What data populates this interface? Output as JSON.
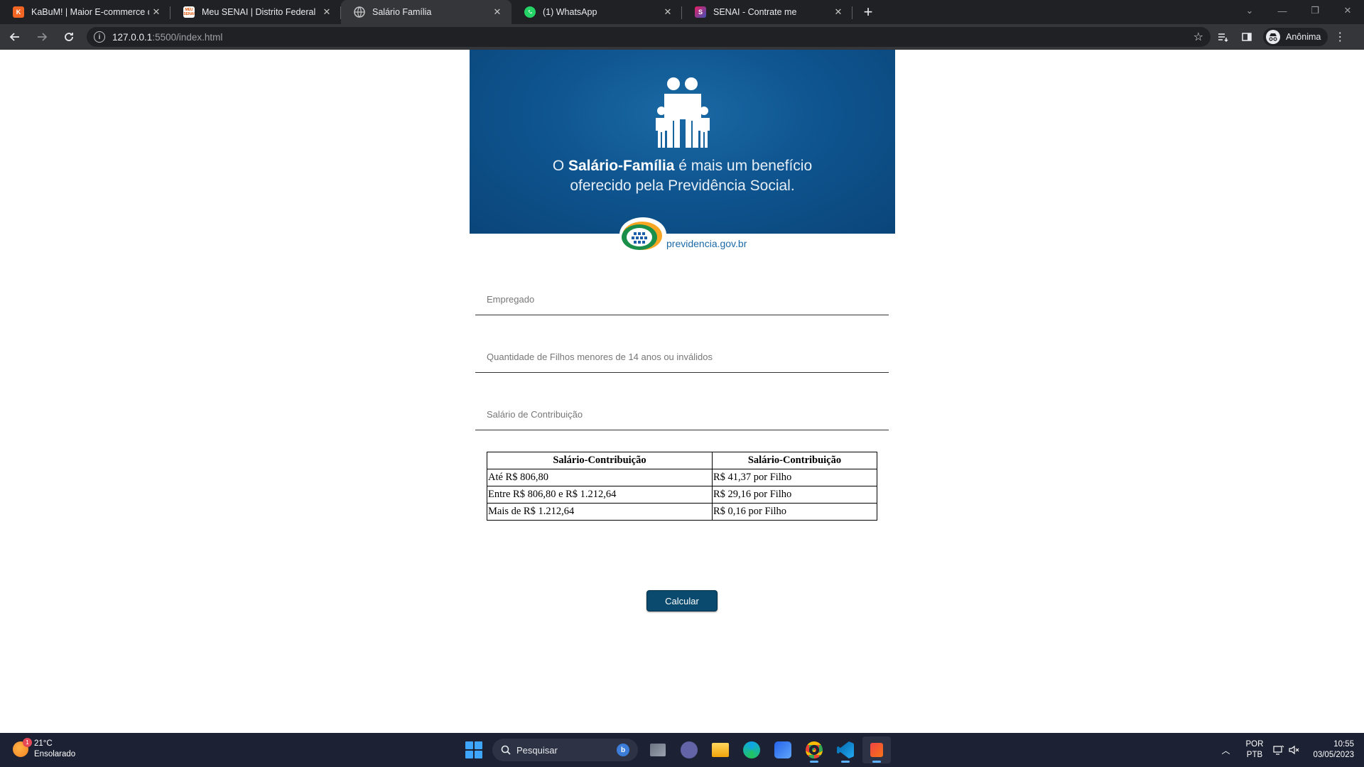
{
  "browser": {
    "tabs": [
      {
        "title": "KaBuM! | Maior E-commerce de Tecnologia",
        "favicon_color": "#f26522",
        "favicon_text": "K",
        "active": false
      },
      {
        "title": "Meu SENAI | Distrito Federal",
        "favicon_color": "#e35205",
        "favicon_text": "MEU SENAI",
        "active": false
      },
      {
        "title": "Salário Família",
        "favicon_color": "#9aa0a6",
        "favicon_text": "",
        "active": true
      },
      {
        "title": "(1) WhatsApp",
        "favicon_color": "#25d366",
        "favicon_text": "",
        "active": false
      },
      {
        "title": "SENAI - Contrate me",
        "favicon_color": "#7b3fe4",
        "favicon_text": "S",
        "active": false
      }
    ],
    "url_host": "127.0.0.1",
    "url_rest": ":5500/index.html",
    "profile_label": "Anônima"
  },
  "banner": {
    "text_prefix": "O ",
    "text_bold": "Salário-Família",
    "text_suffix": " é mais um benefício",
    "text_line2": "oferecido pela Previdência Social.",
    "logo_text": "previdencia.gov.br"
  },
  "form": {
    "empregado_placeholder": "Empregado",
    "filhos_placeholder": "Quantidade de Filhos menores de 14 anos ou inválidos",
    "salario_placeholder": "Salário de Contribuição",
    "submit_label": "Calcular"
  },
  "table": {
    "headers": [
      "Salário-Contribuição",
      "Salário-Contribuição"
    ],
    "rows": [
      [
        "Até R$ 806,80",
        "R$ 41,37 por Filho"
      ],
      [
        "Entre R$ 806,80 e R$ 1.212,64",
        "R$ 29,16 por Filho"
      ],
      [
        "Mais de R$ 1.212,64",
        "R$ 0,16 por Filho"
      ]
    ]
  },
  "taskbar": {
    "weather_temp": "21°C",
    "weather_desc": "Ensolarado",
    "weather_badge": "1",
    "search_placeholder": "Pesquisar",
    "bing_label": "b",
    "lang_top": "POR",
    "lang_bottom": "PTB",
    "time": "10:55",
    "date": "03/05/2023"
  },
  "colors": {
    "button_bg": "#0a4a6e",
    "banner_blue": "#0f5590",
    "taskbar_bg": "#1c2133"
  }
}
